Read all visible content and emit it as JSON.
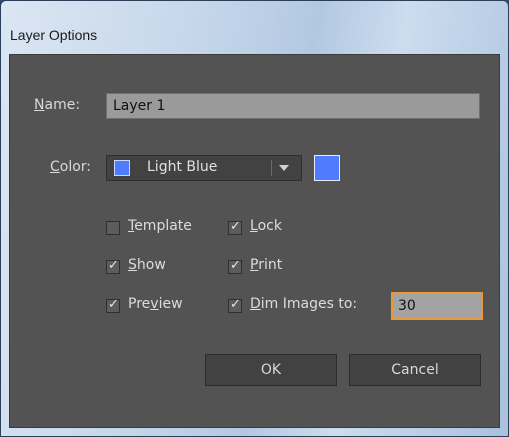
{
  "window": {
    "title": "Layer Options"
  },
  "name_field": {
    "label_prefix": "",
    "label_mnemonic": "N",
    "label_rest": "ame:",
    "value": "Layer 1"
  },
  "color_field": {
    "label_mnemonic": "C",
    "label_rest": "olor:",
    "selected": "Light Blue",
    "swatch_color": "#4f7cff"
  },
  "options": {
    "template": {
      "pre": "",
      "mn": "T",
      "post": "emplate",
      "checked": false
    },
    "lock": {
      "pre": "",
      "mn": "L",
      "post": "ock",
      "checked": true
    },
    "show": {
      "pre": "",
      "mn": "S",
      "post": "how",
      "checked": true
    },
    "print": {
      "pre": "",
      "mn": "P",
      "post": "rint",
      "checked": true
    },
    "preview": {
      "pre": "Pre",
      "mn": "v",
      "post": "iew",
      "checked": true
    },
    "dim": {
      "pre": "",
      "mn": "D",
      "post": "im Images to:",
      "checked": true,
      "value": "30"
    }
  },
  "buttons": {
    "ok": "OK",
    "cancel": "Cancel"
  }
}
